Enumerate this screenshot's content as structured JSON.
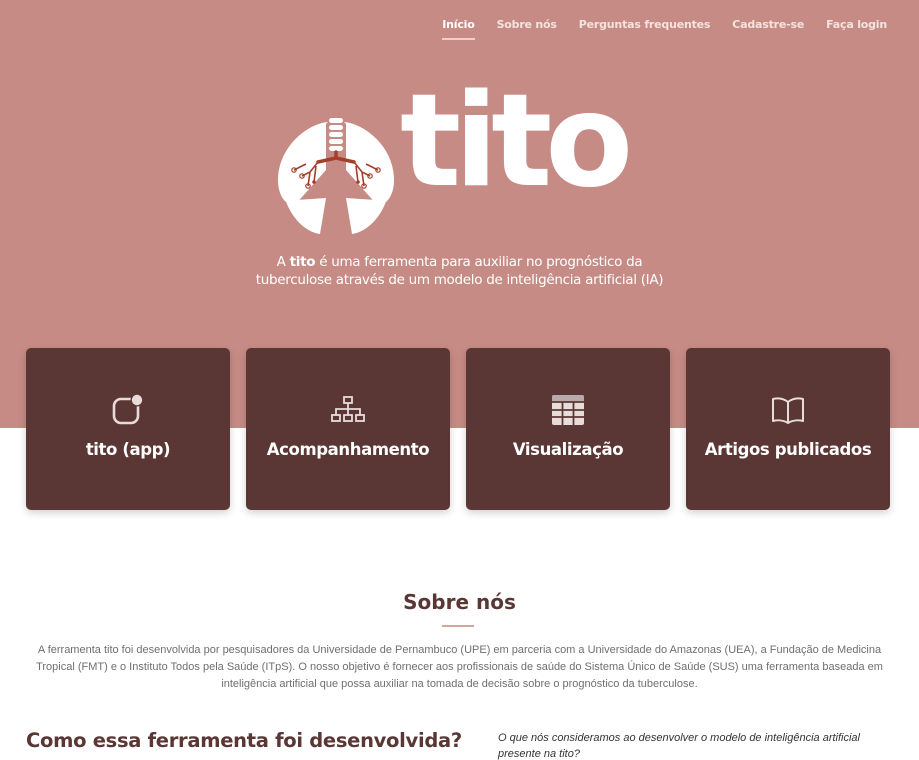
{
  "colors": {
    "hero_bg": "#c68b84",
    "card_bg": "#5a3735",
    "text_brown": "#5a3735",
    "accent_line": "#d6a49d"
  },
  "nav": {
    "items": [
      {
        "label": "Início",
        "active": true
      },
      {
        "label": "Sobre nós"
      },
      {
        "label": "Perguntas frequentes"
      },
      {
        "label": "Cadastre-se"
      },
      {
        "label": "Faça login"
      }
    ]
  },
  "hero": {
    "logo_text": "tito",
    "logo_icon": "lungs-icon",
    "tagline_prefix": "A ",
    "tagline_brand": "tito",
    "tagline_line1": " é uma ferramenta para auxiliar no prognóstico da",
    "tagline_line2": "tuberculose através de um modelo de inteligência artificial (IA)"
  },
  "cards": [
    {
      "label": "tito (app)",
      "icon": "app-notification-icon"
    },
    {
      "label": "Acompanhamento",
      "icon": "sitemap-icon"
    },
    {
      "label": "Visualização",
      "icon": "table-icon"
    },
    {
      "label": "Artigos publicados",
      "icon": "book-icon"
    }
  ],
  "about": {
    "title": "Sobre nós",
    "text": "A ferramenta tito foi desenvolvida por pesquisadores da Universidade de Pernambuco (UPE) em parceria com a Universidade do Amazonas (UEA), a Fundação de Medicina Tropical (FMT) e o Instituto Todos pela Saúde (ITpS). O nosso objetivo é fornecer aos profissionais de saúde do Sistema Único de Saúde (SUS) uma ferramenta baseada em inteligência artificial que possa auxiliar na tomada de decisão sobre o prognóstico da tuberculose."
  },
  "how": {
    "title": "Como essa ferramenta foi desenvolvida?",
    "question": "O que nós consideramos ao desenvolver o modelo de inteligência artificial presente na tito?"
  }
}
